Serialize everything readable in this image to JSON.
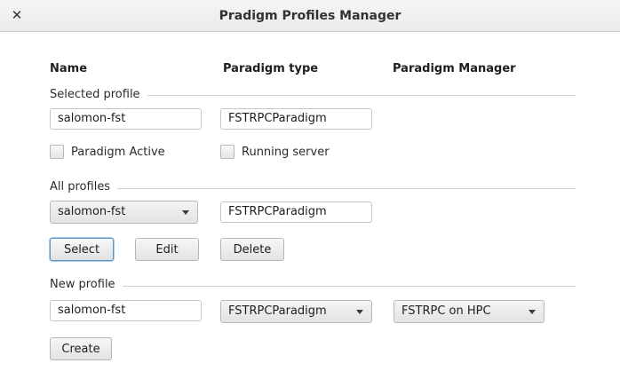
{
  "window": {
    "title": "Pradigm Profiles Manager",
    "close_glyph": "✕"
  },
  "columns": {
    "name": "Name",
    "paradigm_type": "Paradigm type",
    "paradigm_manager": "Paradigm Manager"
  },
  "selected_profile": {
    "section_label": "Selected profile",
    "name_value": "salomon-fst",
    "type_value": "FSTRPCParadigm",
    "paradigm_active_label": "Paradigm Active",
    "paradigm_active_checked": false,
    "running_server_label": "Running server",
    "running_server_checked": false
  },
  "all_profiles": {
    "section_label": "All profiles",
    "profile_select": "salomon-fst",
    "type_value": "FSTRPCParadigm",
    "select_button": "Select",
    "edit_button": "Edit",
    "delete_button": "Delete"
  },
  "new_profile": {
    "section_label": "New profile",
    "name_value": "salomon-fst",
    "type_select": "FSTRPCParadigm",
    "manager_select": "FSTRPC on HPC",
    "create_button": "Create"
  },
  "icons": {
    "close": "close-icon",
    "dropdown": "chevron-down-icon",
    "checkbox": "checkbox-icon"
  }
}
